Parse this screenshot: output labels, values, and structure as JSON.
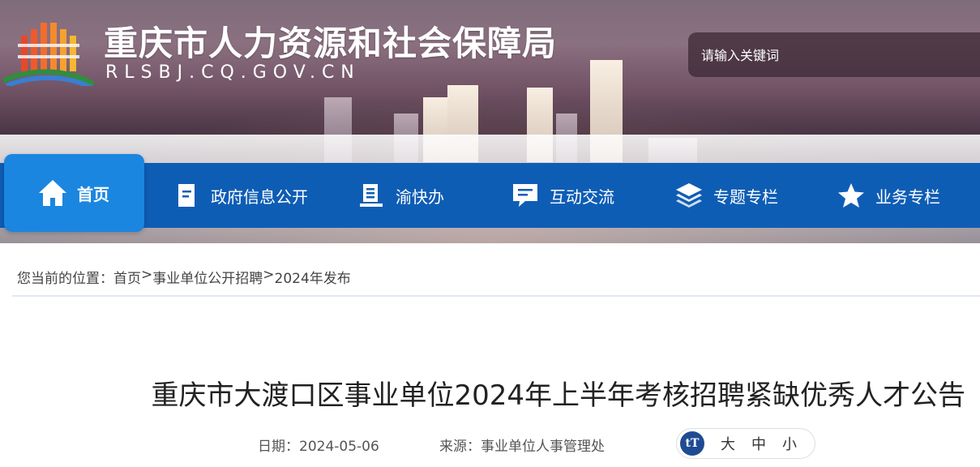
{
  "header": {
    "site_title": "重庆市人力资源和社会保障局",
    "site_domain": "RLSBJ.CQ.GOV.CN",
    "logo_icon": "cq-hrss-logo-icon"
  },
  "search": {
    "placeholder": "请输入关键词"
  },
  "nav": {
    "items": [
      {
        "label": "首页",
        "icon": "home-icon"
      },
      {
        "label": "政府信息公开",
        "icon": "document-icon"
      },
      {
        "label": "渝快办",
        "icon": "service-icon"
      },
      {
        "label": "互动交流",
        "icon": "chat-icon"
      },
      {
        "label": "专题专栏",
        "icon": "layers-icon"
      },
      {
        "label": "业务专栏",
        "icon": "star-icon"
      }
    ]
  },
  "breadcrumb": {
    "prefix": "您当前的位置：",
    "crumbs": [
      "首页",
      "事业单位公开招聘",
      "2024年发布"
    ],
    "separator": ">"
  },
  "article": {
    "title": "重庆市大渡口区事业单位2024年上半年考核招聘紧缺优秀人才公告",
    "date_label": "日期：",
    "date": "2024-05-06",
    "source_label": "来源：",
    "source": "事业单位人事管理处",
    "font_size_icon": "font-size-icon",
    "font_size_options": [
      "大",
      "中",
      "小"
    ]
  },
  "colors": {
    "nav_bg": "#0e5db5",
    "nav_home_bg": "#1b86e0",
    "font_icon_bg": "#1f4b94"
  }
}
